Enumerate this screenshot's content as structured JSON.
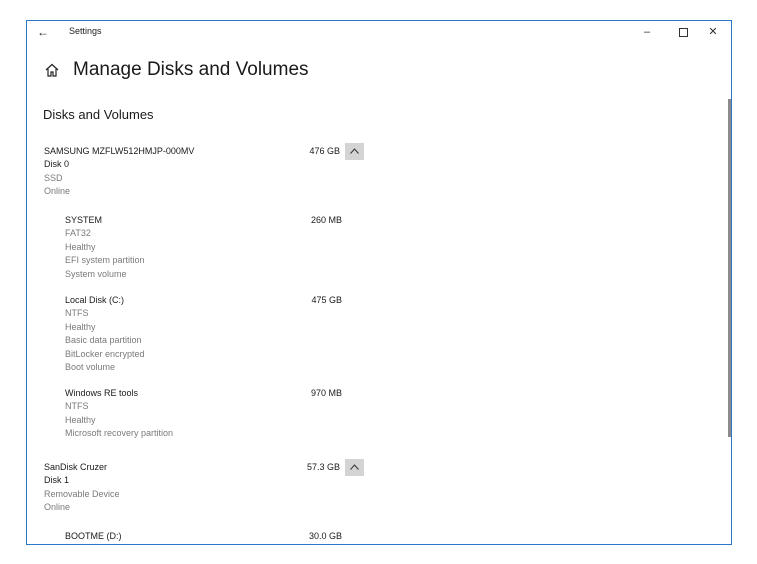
{
  "titlebar": {
    "back_label": "←",
    "title": "Settings",
    "minimize_label": "–",
    "close_label": "✕"
  },
  "header": {
    "icon": "home-icon",
    "title": "Manage Disks and Volumes"
  },
  "section": {
    "title": "Disks and Volumes"
  },
  "disks": [
    {
      "name": "SAMSUNG MZFLW512HMJP-000MV",
      "size": "476 GB",
      "number": "Disk 0",
      "type": "SSD",
      "status": "Online",
      "volumes": [
        {
          "name": "SYSTEM",
          "size": "260 MB",
          "details": [
            "FAT32",
            "Healthy",
            "EFI system partition",
            "System volume"
          ]
        },
        {
          "name": "Local Disk (C:)",
          "size": "475 GB",
          "details": [
            "NTFS",
            "Healthy",
            "Basic data partition",
            "BitLocker encrypted",
            "Boot volume"
          ]
        },
        {
          "name": "Windows RE tools",
          "size": "970 MB",
          "details": [
            "NTFS",
            "Healthy",
            "Microsoft recovery partition"
          ]
        }
      ]
    },
    {
      "name": "SanDisk Cruzer",
      "size": "57.3 GB",
      "number": "Disk 1",
      "type": "Removable Device",
      "status": "Online",
      "volumes": [
        {
          "name": "BOOTME (D:)",
          "size": "30.0 GB",
          "details": []
        }
      ]
    }
  ],
  "colors": {
    "window_border": "#2b78c6",
    "secondary_text": "#7a7a7a",
    "collapse_button_bg": "#d4d4d4"
  }
}
